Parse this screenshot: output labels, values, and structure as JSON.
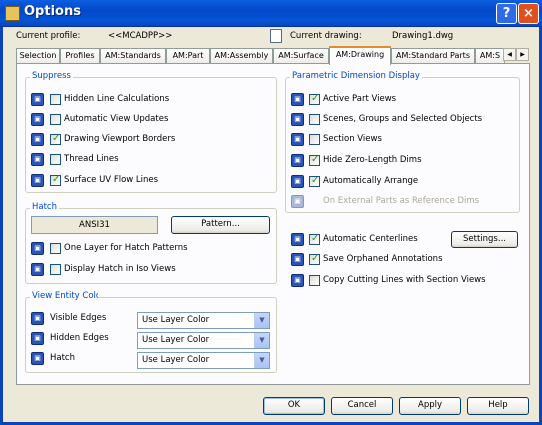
{
  "window": {
    "title": "Options",
    "help_label": "?",
    "close_label": "×"
  },
  "profile": {
    "label": "Current profile:",
    "value": "<<MCADPP>>"
  },
  "drawing": {
    "label": "Current drawing:",
    "value": "Drawing1.dwg"
  },
  "tabs": [
    "Selection",
    "Profiles",
    "AM:Standards",
    "AM:Part",
    "AM:Assembly",
    "AM:Surface",
    "AM:Drawing",
    "AM:Standard Parts",
    "AM:S"
  ],
  "active_tab": "AM:Drawing",
  "tab_scroll": {
    "left": "◀",
    "right": "▶"
  },
  "suppress": {
    "title": "Suppress",
    "items": [
      {
        "label": "Hidden Line Calculations",
        "checked": false
      },
      {
        "label": "Automatic View Updates",
        "checked": false
      },
      {
        "label": "Drawing Viewport Borders",
        "checked": true
      },
      {
        "label": "Thread Lines",
        "checked": false
      },
      {
        "label": "Surface UV Flow Lines",
        "checked": true
      }
    ]
  },
  "hatch": {
    "title": "Hatch",
    "pattern_value": "ANSI31",
    "pattern_button": "Pattern...",
    "items": [
      {
        "label": "One Layer for Hatch Patterns",
        "checked": false
      },
      {
        "label": "Display Hatch in Iso Views",
        "checked": false
      }
    ]
  },
  "view_entity": {
    "title": "View Entity Color",
    "rows": [
      {
        "label": "Visible Edges",
        "value": "Use Layer Color"
      },
      {
        "label": "Hidden Edges",
        "value": "Use Layer Color"
      },
      {
        "label": "Hatch",
        "value": "Use Layer Color"
      }
    ]
  },
  "parametric": {
    "title": "Parametric Dimension Display",
    "items": [
      {
        "label": "Active Part Views",
        "checked": true,
        "disabled": false
      },
      {
        "label": "Scenes, Groups and Selected Objects",
        "checked": false,
        "disabled": false
      },
      {
        "label": "Section Views",
        "checked": false,
        "disabled": false
      },
      {
        "label": "Hide Zero-Length Dims",
        "checked": true,
        "disabled": false
      },
      {
        "label": "Automatically Arrange",
        "checked": true,
        "disabled": false
      },
      {
        "label": "On External Parts as Reference Dims",
        "checked": false,
        "disabled": true
      }
    ]
  },
  "right_options": {
    "items": [
      {
        "label": "Automatic Centerlines",
        "checked": true
      },
      {
        "label": "Save Orphaned Annotations",
        "checked": true
      },
      {
        "label": "Copy Cutting Lines with Section Views",
        "checked": false
      }
    ],
    "settings_button": "Settings..."
  },
  "footer": {
    "ok": "OK",
    "cancel": "Cancel",
    "apply": "Apply",
    "help": "Help"
  },
  "icons": {
    "option_icon": "settings-cube-icon",
    "drawing_icon": "drawing-file-icon",
    "accent": "#0046D5"
  }
}
